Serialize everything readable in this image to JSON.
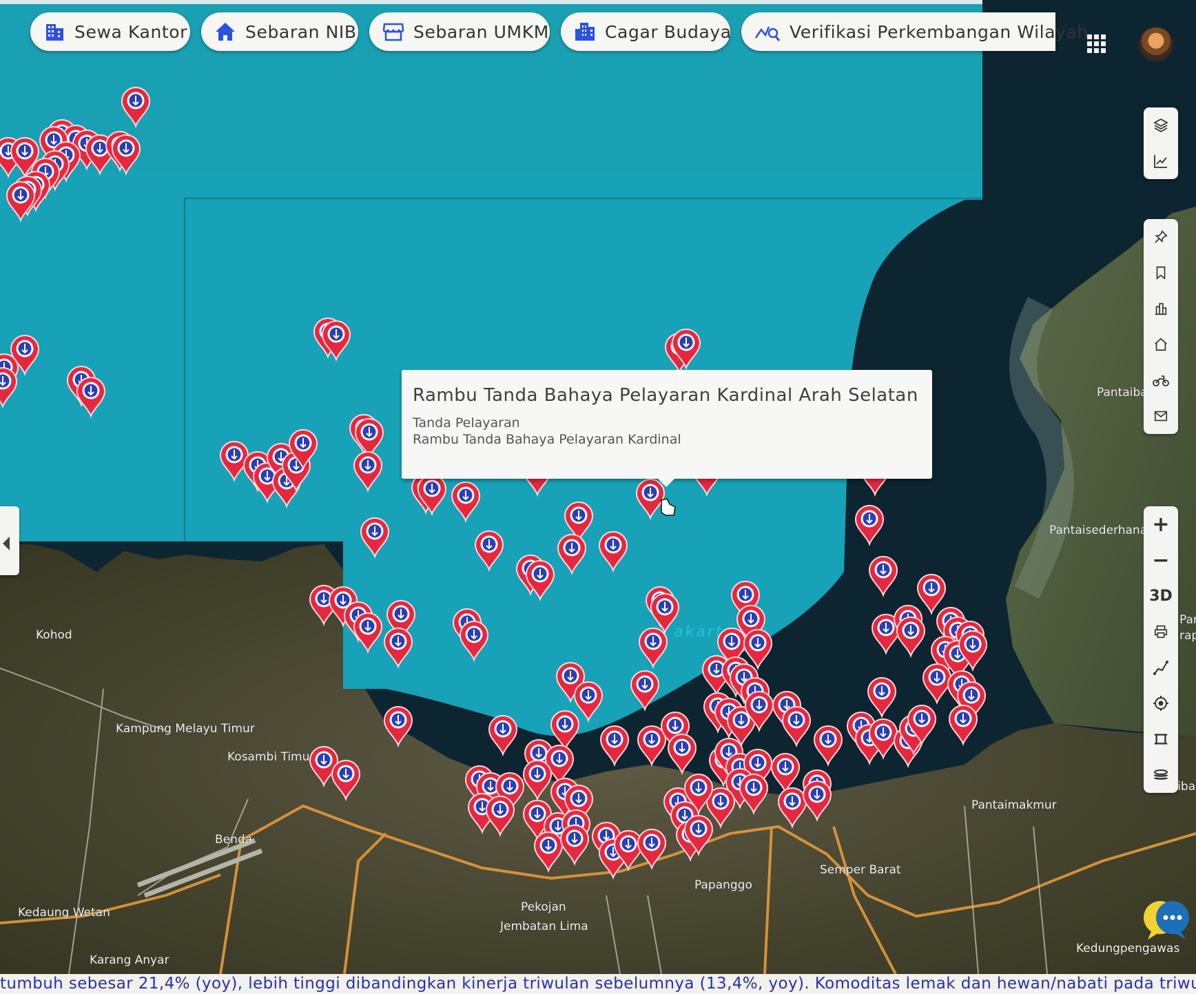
{
  "top_tabs": [
    {
      "label": "Sewa Kantor",
      "icon": "office-building-icon"
    },
    {
      "label": "Sebaran NIB",
      "icon": "home-icon"
    },
    {
      "label": "Sebaran UMKM",
      "icon": "storefront-icon"
    },
    {
      "label": "Cagar Budaya",
      "icon": "heritage-building-icon"
    },
    {
      "label": "Verifikasi Perkembangan Wilayah",
      "icon": "analytics-search-icon"
    }
  ],
  "toolbar_top": [
    "layers-icon",
    "chart-icon"
  ],
  "toolbar_mid": [
    "pin-icon",
    "bookmark-icon",
    "building-icon",
    "house-icon",
    "motorbike-icon",
    "mail-icon"
  ],
  "toolbar_bottom": {
    "zoom_in": "+",
    "zoom_out": "−",
    "view_3d": "3D",
    "icons": [
      "print-icon",
      "route-icon",
      "locate-icon",
      "crop-icon",
      "basemap-icon"
    ]
  },
  "popup": {
    "title": "Rambu Tanda Bahaya Pelayaran Kardinal Arah Selatan",
    "category": "Tanda Pelayaran",
    "description": "Rambu Tanda Bahaya Pelayaran Kardinal"
  },
  "map_labels": [
    "Kohod",
    "Kampung Melayu Timur",
    "Kosambi Timur",
    "Benda",
    "Kedaung Wetan",
    "Karang Anyar",
    "Pekojan",
    "Jembatan Lima",
    "Papanggo",
    "Semper Barat",
    "Pantaimakmur",
    "Kedungpengawas",
    "Pantaisederhana",
    "Pantaiba",
    "Bunibak",
    "akarta   ay",
    "Par",
    "rap"
  ],
  "ticker_text": "tumbuh sebesar 21,4% (yoy), lebih tinggi dibandingkan kinerja triwulan sebelumnya (13,4%, yoy). Komoditas lemak dan hewan/nabati pada triwu",
  "colors": {
    "sea_overlay": "#17a3b8",
    "sea_deep": "#0d2531",
    "marker_red": "#e8283f",
    "marker_inner": "#2a3fb5",
    "tab_bg": "#f6f6f3",
    "ticker_text": "#2a31a8"
  }
}
